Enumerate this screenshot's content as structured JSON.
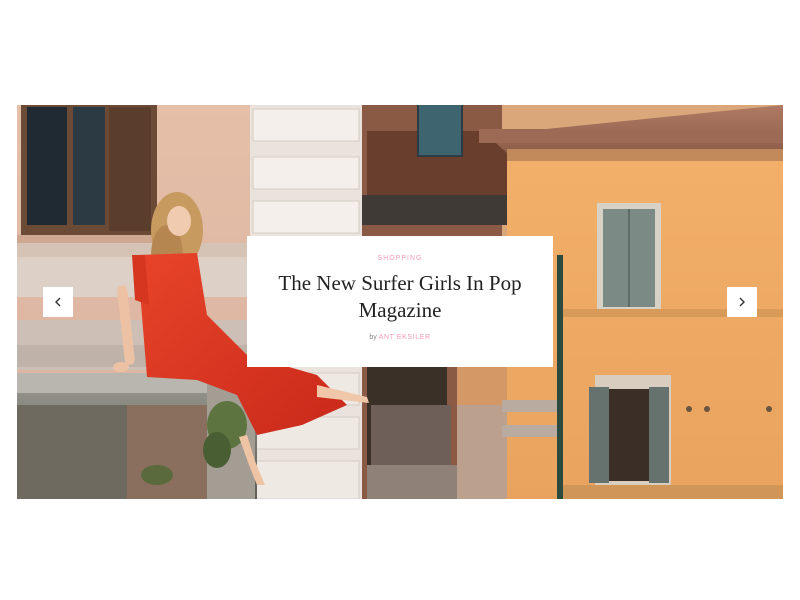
{
  "slide": {
    "category": "Shopping",
    "title": "The New Surfer Girls In Pop Magazine",
    "byline_prefix": "by",
    "author": "Ant Eksiler"
  },
  "navigation": {
    "prev_icon": "chevron-left-icon",
    "next_icon": "chevron-right-icon"
  },
  "colors": {
    "accent_pink": "#f19ab9",
    "title_text": "#222222",
    "dress_red": "#e0341f",
    "building_orange": "#eea85b"
  }
}
